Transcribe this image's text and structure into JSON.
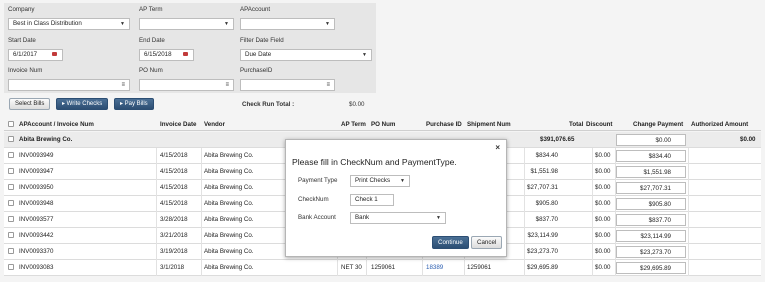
{
  "filters": {
    "company_label": "Company",
    "company_value": "Best in Class Distribution",
    "ap_term_label": "AP Term",
    "ap_term_value": "",
    "ap_account_label": "APAccount",
    "ap_account_value": "",
    "start_date_label": "Start Date",
    "start_date_value": "6/1/2017",
    "end_date_label": "End Date",
    "end_date_value": "6/15/2018",
    "filter_date_field_label": "Filter Date Field",
    "filter_date_field_value": "Due Date",
    "invoice_num_label": "Invoice Num",
    "invoice_num_value": "",
    "po_num_label": "PO Num",
    "po_num_value": "",
    "purchase_id_label": "PurchaseID",
    "purchase_id_value": ""
  },
  "toolbar": {
    "select_bills": "Select Bills",
    "write_checks": "▸ Write Checks",
    "pay_bills": "▸ Pay Bills",
    "check_run_total_label": "Check Run Total :",
    "check_run_total_value": "$0.00"
  },
  "table": {
    "headers": {
      "account_invoice": "APAccount / Invoice Num",
      "invoice_date": "Invoice Date",
      "vendor": "Vendor",
      "ap_term": "AP Term",
      "po_num": "PO Num",
      "purchase_id": "Purchase ID",
      "shipment_num": "Shipment Num",
      "total": "Total",
      "discount": "Discount",
      "change_payment": "Change Payment",
      "authorized_amount": "Authorized Amount"
    },
    "group": {
      "name": "Abita Brewing Co.",
      "total": "$391,076.65",
      "change_payment": "$0.00",
      "authorized_amount": "$0.00"
    },
    "rows": [
      {
        "invoice": "INV0093949",
        "date": "4/15/2018",
        "vendor": "Abita Brewing Co.",
        "ap_term": "",
        "po_num": "",
        "purchase_id": "",
        "shipment_num": "",
        "total": "$834.40",
        "discount": "$0.00",
        "payment": "$834.40"
      },
      {
        "invoice": "INV0093947",
        "date": "4/15/2018",
        "vendor": "Abita Brewing Co.",
        "ap_term": "",
        "po_num": "",
        "purchase_id": "",
        "shipment_num": "",
        "total": "$1,551.98",
        "discount": "$0.00",
        "payment": "$1,551.98"
      },
      {
        "invoice": "INV0093950",
        "date": "4/15/2018",
        "vendor": "Abita Brewing Co.",
        "ap_term": "",
        "po_num": "",
        "purchase_id": "",
        "shipment_num": "",
        "total": "$27,707.31",
        "discount": "$0.00",
        "payment": "$27,707.31"
      },
      {
        "invoice": "INV0093948",
        "date": "4/15/2018",
        "vendor": "Abita Brewing Co.",
        "ap_term": "",
        "po_num": "",
        "purchase_id": "",
        "shipment_num": "",
        "total": "$905.80",
        "discount": "$0.00",
        "payment": "$905.80"
      },
      {
        "invoice": "INV0093577",
        "date": "3/28/2018",
        "vendor": "Abita Brewing Co.",
        "ap_term": "",
        "po_num": "",
        "purchase_id": "",
        "shipment_num": "",
        "total": "$837.70",
        "discount": "$0.00",
        "payment": "$837.70"
      },
      {
        "invoice": "INV0093442",
        "date": "3/21/2018",
        "vendor": "Abita Brewing Co.",
        "ap_term": "",
        "po_num": "",
        "purchase_id": "",
        "shipment_num": "",
        "total": "$23,114.99",
        "discount": "$0.00",
        "payment": "$23,114.99"
      },
      {
        "invoice": "INV0093370",
        "date": "3/19/2018",
        "vendor": "Abita Brewing Co.",
        "ap_term": "",
        "po_num": "",
        "purchase_id": "",
        "shipment_num": "",
        "total": "$23,273.70",
        "discount": "$0.00",
        "payment": "$23,273.70"
      },
      {
        "invoice": "INV0093083",
        "date": "3/1/2018",
        "vendor": "Abita Brewing Co.",
        "ap_term": "NET 30",
        "po_num": "1259061",
        "purchase_id": "18389",
        "shipment_num": "1259061",
        "total": "$29,695.89",
        "discount": "$0.00",
        "payment": "$29,695.89"
      }
    ]
  },
  "modal": {
    "title": "Please fill in CheckNum and PaymentType.",
    "close": "×",
    "payment_type_label": "Payment Type",
    "payment_type_value": "Print Checks",
    "checknum_label": "CheckNum",
    "checknum_value": "Check 1",
    "bank_account_label": "Bank Account",
    "bank_account_value": "Bank",
    "continue_label": "Continue",
    "cancel_label": "Cancel"
  },
  "colors": {
    "primary_button": "#2c4e73",
    "link": "#2a5db0",
    "calendar_icon": "#c23b3b"
  },
  "icons": {
    "dropdown": "chevron-down-icon",
    "calendar": "calendar-icon",
    "lookup": "lookup-icon",
    "checkbox": "checkbox-icon",
    "close": "close-icon"
  }
}
